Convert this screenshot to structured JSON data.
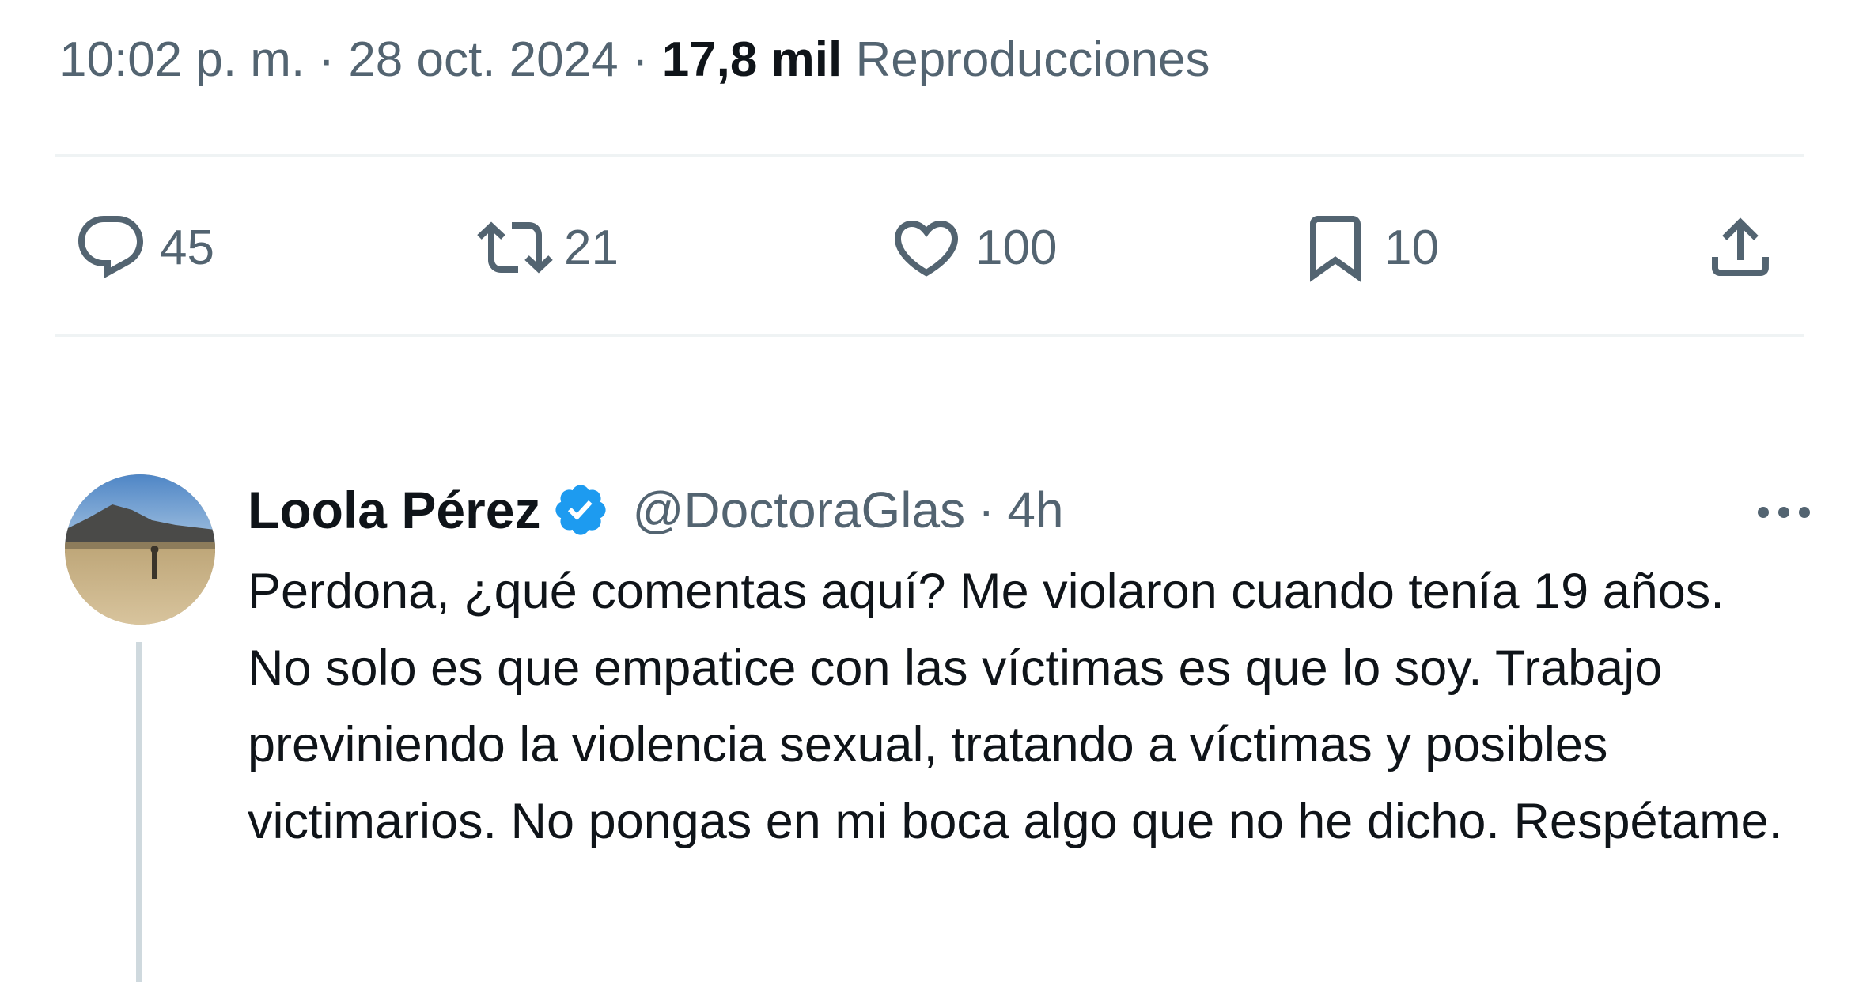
{
  "tweet": {
    "time": "10:02 p. m.",
    "separator": "·",
    "date": "28 oct. 2024",
    "views_count": "17,8 mil",
    "views_label": "Reproducciones",
    "actions": {
      "replies": {
        "icon": "reply-icon",
        "count": "45"
      },
      "retweets": {
        "icon": "retweet-icon",
        "count": "21"
      },
      "likes": {
        "icon": "heart-icon",
        "count": "100"
      },
      "bookmarks": {
        "icon": "bookmark-icon",
        "count": "10"
      },
      "share": {
        "icon": "share-icon"
      }
    }
  },
  "reply": {
    "display_name": "Loola Pérez",
    "verified": true,
    "verified_color": "#1d9bf0",
    "handle": "@DoctoraGlas",
    "separator": "·",
    "time_ago": "4h",
    "text": "Perdona, ¿qué comentas aquí? Me violaron cuando tenía 19 años. No solo es que empatice con las víctimas es que lo soy. Trabajo previniendo la violencia sexual, tratando a víctimas y posibles victimarios. No pongas en mi boca algo que no he dicho. Respétame."
  }
}
